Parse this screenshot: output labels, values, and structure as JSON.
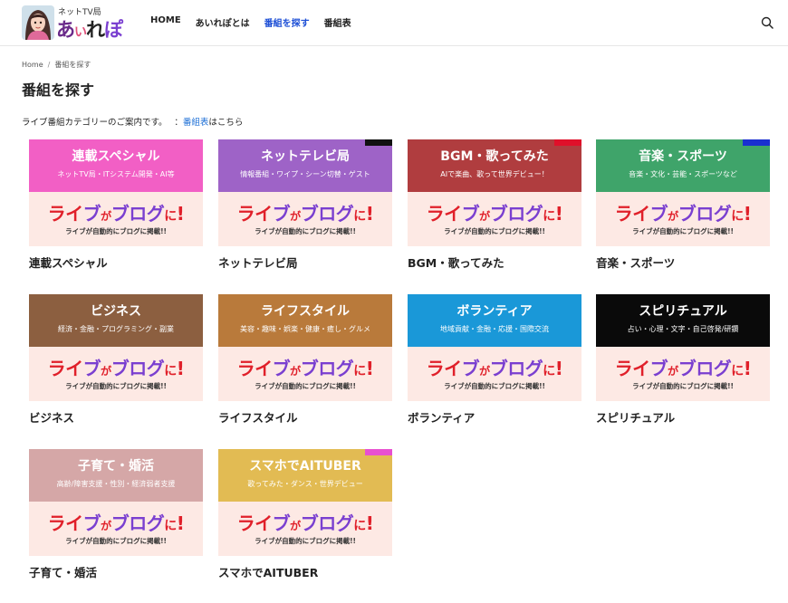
{
  "header": {
    "logo_small": "ネットTV局",
    "logo_main": "あいれぽ",
    "nav": [
      {
        "label": "HOME"
      },
      {
        "label": "あいれぽとは"
      },
      {
        "label": "番組を探す"
      },
      {
        "label": "番組表"
      }
    ],
    "nav_active_index": 2
  },
  "breadcrumb": {
    "home": "Home",
    "separator": "/",
    "current": "番組を探す"
  },
  "page": {
    "title": "番組を探す",
    "intro_text": "ライブ番組カテゴリーのご案内です。",
    "intro_link": "番組表",
    "intro_suffix": "はこちら",
    "intro_colon": "："
  },
  "blog_panel": {
    "main_parts": [
      "ラ",
      "イ",
      "ブ",
      "が",
      "ブ",
      "ロ",
      "グ",
      "に",
      "!"
    ],
    "sub": "ライブが自動的にブログに掲載!!"
  },
  "categories": [
    {
      "title": "連載スペシャル",
      "banner_title": "連載スペシャル",
      "banner_sub": "ネットTV局・ITシステム開発・AI等",
      "color": "#f25fc5",
      "corner": ""
    },
    {
      "title": "ネットテレビ局",
      "banner_title": "ネットテレビ局",
      "banner_sub": "情報番組・ワイプ・シーン切替・ゲスト",
      "color": "#9e63c7",
      "corner": "#111111"
    },
    {
      "title": "BGM・歌ってみた",
      "banner_title": "BGM・歌ってみた",
      "banner_sub": "AIで楽曲、歌って世界デビュー！",
      "color": "#b03d3f",
      "corner": "#e0102a"
    },
    {
      "title": "音楽・スポーツ",
      "banner_title": "音楽・スポーツ",
      "banner_sub": "音楽・文化・芸能・スポーツなど",
      "color": "#3fa46a",
      "corner": "#1a2fd0"
    },
    {
      "title": "ビジネス",
      "banner_title": "ビジネス",
      "banner_sub": "経済・金融・プログラミング・副業",
      "color": "#8c5f40",
      "corner": ""
    },
    {
      "title": "ライフスタイル",
      "banner_title": "ライフスタイル",
      "banner_sub": "美容・趣味・娯楽・健康・癒し・グルメ",
      "color": "#b97a3b",
      "corner": ""
    },
    {
      "title": "ボランティア",
      "banner_title": "ボランティア",
      "banner_sub": "地域貢献・金融・応援・国際交流",
      "color": "#1a98d8",
      "corner": ""
    },
    {
      "title": "スピリチュアル",
      "banner_title": "スピリチュアル",
      "banner_sub": "占い・心理・文字・自己啓発/研鑽",
      "color": "#0a0a0a",
      "corner": ""
    },
    {
      "title": "子育て・婚活",
      "banner_title": "子育て・婚活",
      "banner_sub": "高齢/障害支援・性別・経済弱者支援",
      "color": "#d5a7a7",
      "corner": ""
    },
    {
      "title": "スマホでAITUBER",
      "banner_title": "スマホでAITUBER",
      "banner_sub": "歌ってみた・ダンス・世界デビュー",
      "color": "#e2bb53",
      "corner": "#e84fd0"
    }
  ],
  "colors": {
    "accent": "#1d4fd6",
    "link": "#1d6fd6",
    "blog_red": "#e0202a",
    "blog_purple": "#7a3fd0",
    "blog_bg": "#fde9e4"
  },
  "icons": {
    "search": "search-icon",
    "avatar": "avatar"
  }
}
